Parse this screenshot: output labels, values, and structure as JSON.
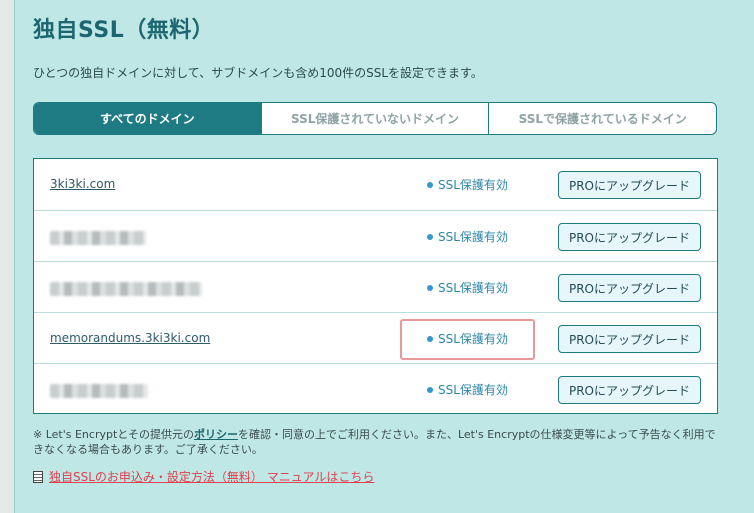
{
  "page": {
    "title": "独自SSL（無料）",
    "description": "ひとつの独自ドメインに対して、サブドメインも含め100件のSSLを設定できます。"
  },
  "tabs": [
    {
      "label": "すべてのドメイン",
      "active": true
    },
    {
      "label": "SSL保護されていないドメイン",
      "active": false
    },
    {
      "label": "SSLで保護されているドメイン",
      "active": false
    }
  ],
  "domains": [
    {
      "name": "3ki3ki.com",
      "blurred": false,
      "status": "SSL保護有効",
      "button": "PROにアップグレード"
    },
    {
      "name": "",
      "blurred": true,
      "status": "SSL保護有効",
      "button": "PROにアップグレード"
    },
    {
      "name": "",
      "blurred": true,
      "status": "SSL保護有効",
      "button": "PROにアップグレード"
    },
    {
      "name": "memorandums.3ki3ki.com",
      "blurred": false,
      "status": "SSL保護有効",
      "button": "PROにアップグレード",
      "highlighted": true
    },
    {
      "name": "",
      "blurred": true,
      "status": "SSL保護有効",
      "button": "PROにアップグレード"
    }
  ],
  "note": {
    "prefix": "※ Let's Encryptとその提供元の",
    "link": "ポリシー",
    "suffix": "を確認・同意の上でご利用ください。また、Let's Encryptの仕様変更等によって予告なく利用できなくなる場合もあります。ご了承ください。"
  },
  "manual": {
    "icon": "document-icon",
    "label": "独自SSLのお申込み・設定方法（無料） マニュアルはこちら"
  },
  "colors": {
    "panel_bg": "#bfe7e5",
    "accent": "#1e7a83",
    "status_blue": "#2d86a8",
    "highlight_border": "#e89a9a",
    "link_red": "#e0414e"
  }
}
